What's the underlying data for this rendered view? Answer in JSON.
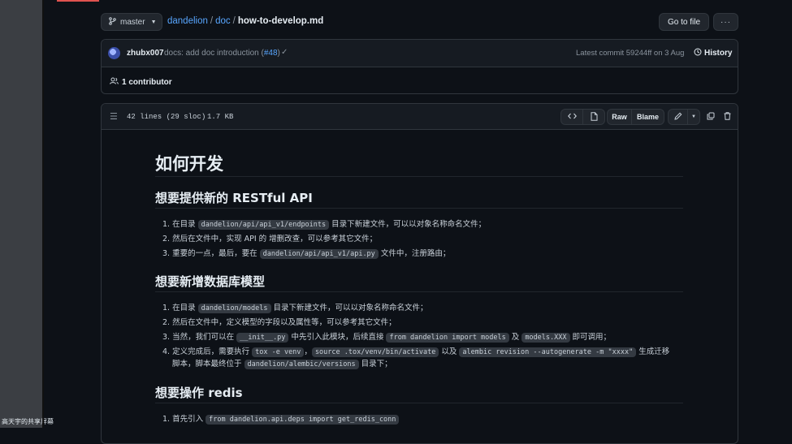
{
  "overlay": {
    "share_label": "高天宇的共享屏幕"
  },
  "toolbar": {
    "branch": "master",
    "breadcrumb": {
      "repo": "dandelion",
      "sep1": "/",
      "folder": "doc",
      "sep2": "/",
      "file": "how-to-develop.md"
    },
    "goto_file": "Go to file",
    "more": "···"
  },
  "commit": {
    "author": "zhubx007",
    "message": "docs: add doc introduction (",
    "pr": "#48",
    "message_end": ")",
    "latest": "Latest commit 59244ff on 3 Aug",
    "history": "History",
    "contributors_count": "1 contributor"
  },
  "file_header": {
    "lines": "42 lines (29 sloc)",
    "size": "1.7 KB",
    "raw": "Raw",
    "blame": "Blame"
  },
  "markdown": {
    "h1": "如何开发",
    "sections": [
      {
        "heading": "想要提供新的 RESTful API",
        "items": [
          {
            "num": "1.",
            "parts": [
              "在目录 ",
              {
                "code": "dandelion/api/api_v1/endpoints"
              },
              " 目录下新建文件，可以以对象名称命名文件；"
            ]
          },
          {
            "num": "2.",
            "parts": [
              "然后在文件中，实现 API 的 增删改查，可以参考其它文件；"
            ]
          },
          {
            "num": "3.",
            "parts": [
              "重要的一点，最后，要在 ",
              {
                "code": "dandelion/api/api_v1/api.py"
              },
              " 文件中，注册路由；"
            ]
          }
        ]
      },
      {
        "heading": "想要新增数据库模型",
        "items": [
          {
            "num": "1.",
            "parts": [
              "在目录 ",
              {
                "code": "dandelion/models"
              },
              " 目录下新建文件，可以以对象名称命名文件；"
            ]
          },
          {
            "num": "2.",
            "parts": [
              "然后在文件中，定义模型的字段以及属性等，可以参考其它文件；"
            ]
          },
          {
            "num": "3.",
            "parts": [
              "当然，我们可以在 ",
              {
                "code": "__init__.py"
              },
              " 中先引入此模块，后续直接 ",
              {
                "code": "from dandelion import models"
              },
              " 及 ",
              {
                "code": "models.XXX"
              },
              " 即可调用；"
            ]
          },
          {
            "num": "4.",
            "parts": [
              "定义完成后，需要执行 ",
              {
                "code": "tox -e venv"
              },
              "，",
              {
                "code": "source .tox/venv/bin/activate"
              },
              " 以及 ",
              {
                "code": "alembic revision --autogenerate -m \"xxxx\""
              },
              " 生成迁移"
            ]
          },
          {
            "num": "",
            "parts": [
              "脚本，脚本最终位于 ",
              {
                "code": "dandelion/alembic/versions"
              },
              " 目录下；"
            ]
          }
        ]
      },
      {
        "heading": "想要操作 redis",
        "items": [
          {
            "num": "1.",
            "parts": [
              "首先引入 ",
              {
                "code": "from dandelion.api.deps import get_redis_conn"
              }
            ]
          }
        ]
      }
    ]
  },
  "colors": {
    "background": "#0d1117",
    "link": "#58a6ff",
    "border": "#30363d",
    "code_bg": "#343a42"
  }
}
